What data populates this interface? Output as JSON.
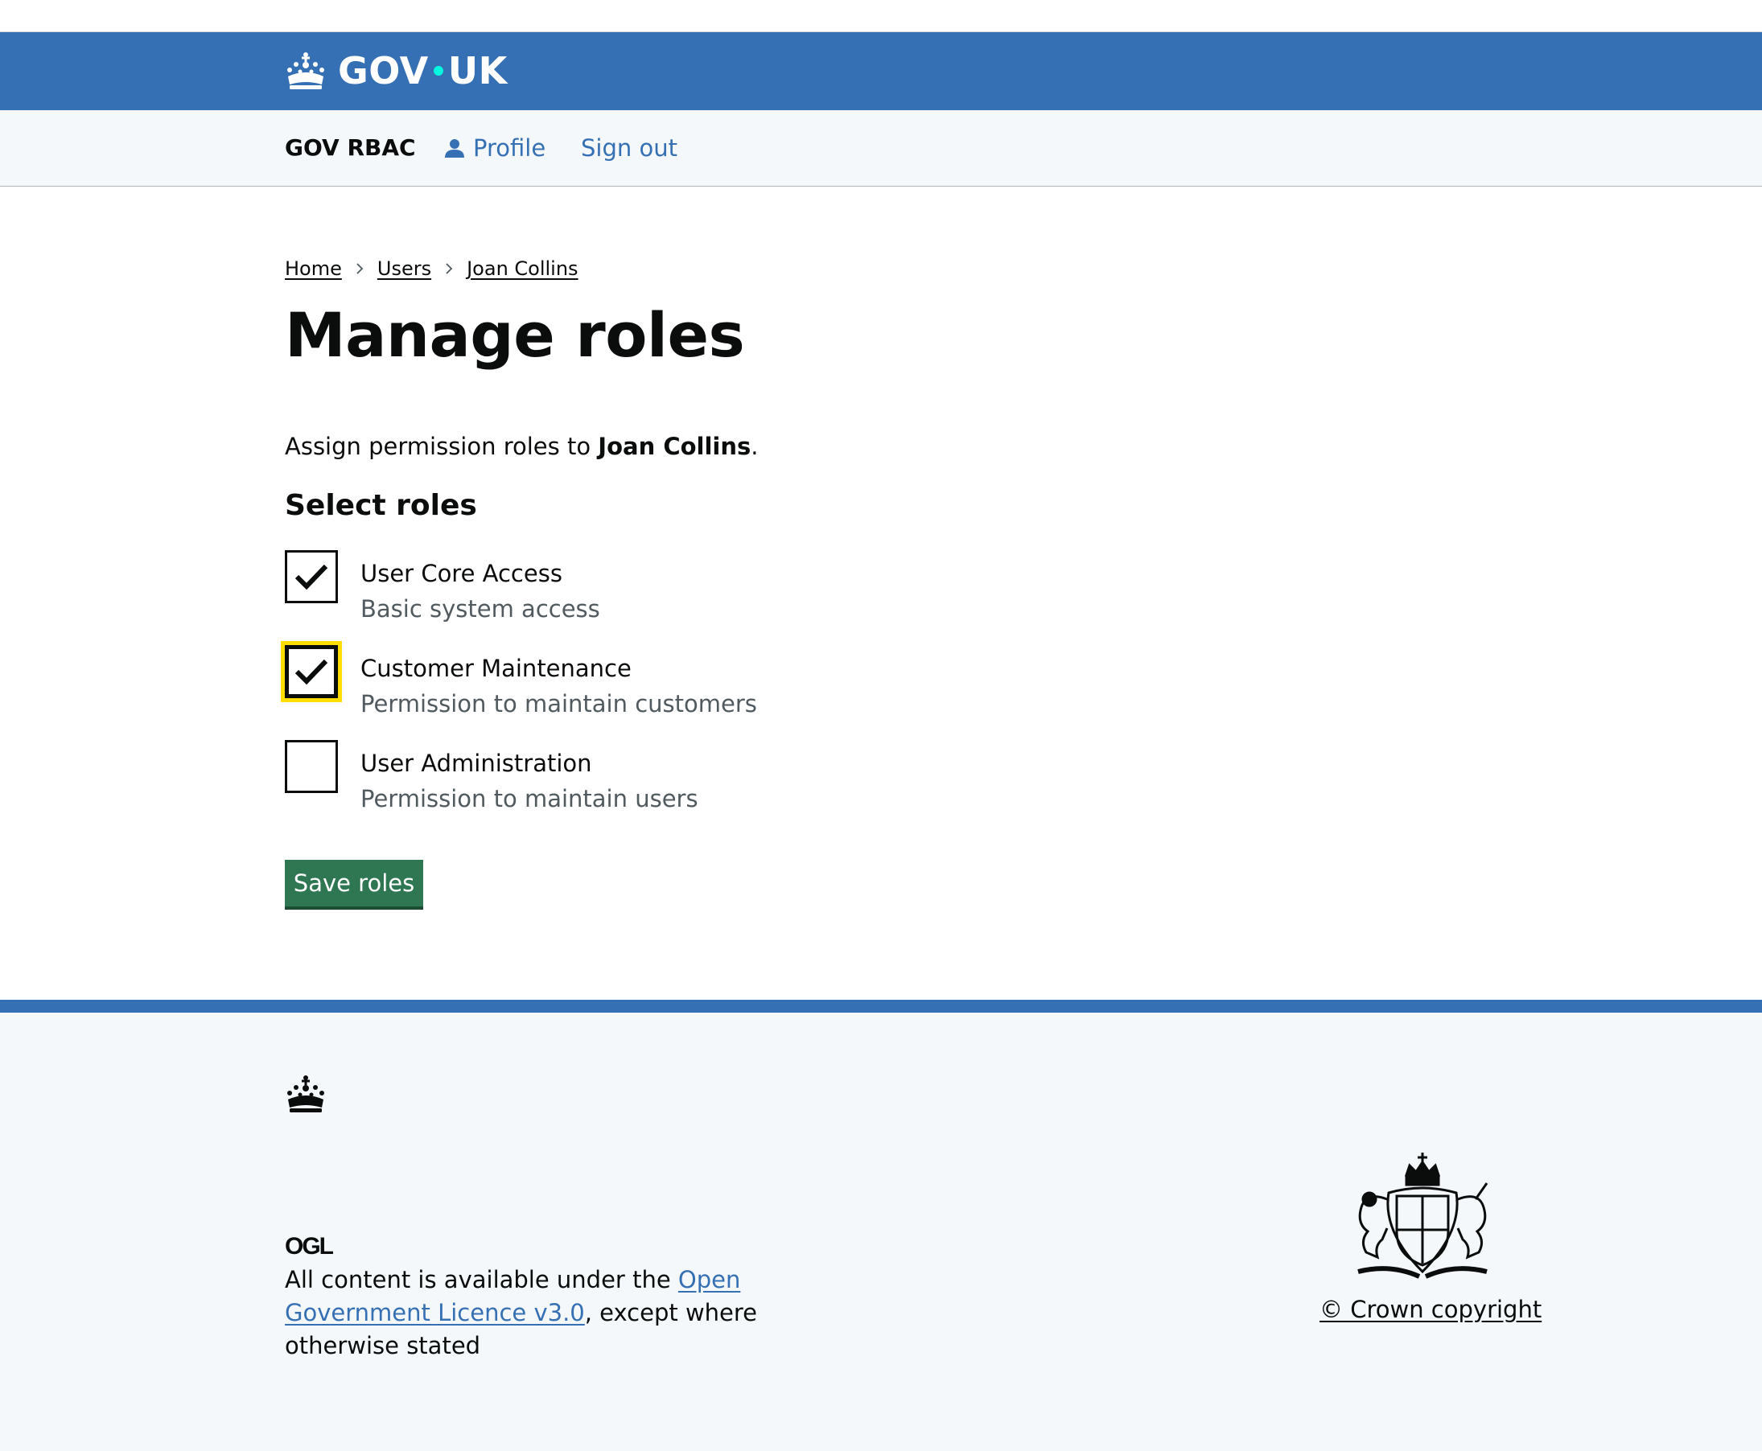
{
  "header": {
    "logo_text_left": "GOV",
    "logo_text_right": "UK",
    "logo_icon": "crown-icon",
    "brand_color": "#3670b4",
    "dot_color": "#00ffe0"
  },
  "service_nav": {
    "service_name": "GOV RBAC",
    "profile_label": "Profile",
    "profile_icon": "person-icon",
    "signout_label": "Sign out"
  },
  "breadcrumbs": [
    "Home",
    "Users",
    "Joan Collins"
  ],
  "page": {
    "title": "Manage roles",
    "lead_prefix": "Assign permission roles to ",
    "lead_name": "Joan Collins",
    "lead_suffix": ".",
    "legend": "Select roles"
  },
  "roles": [
    {
      "label": "User Core Access",
      "hint": "Basic system access",
      "checked": true,
      "focused": false
    },
    {
      "label": "Customer Maintenance",
      "hint": "Permission to maintain customers",
      "checked": true,
      "focused": true
    },
    {
      "label": "User Administration",
      "hint": "Permission to maintain users",
      "checked": false,
      "focused": false
    }
  ],
  "actions": {
    "save_label": "Save roles",
    "save_color": "#2f7653"
  },
  "footer": {
    "ogl_label": "OGL",
    "licence_prefix": "All content is available under the ",
    "licence_link": "Open Government Licence v3.0",
    "licence_suffix": ", except where otherwise stated",
    "crest_icon": "royal-coat-of-arms-icon",
    "copyright": "© Crown copyright"
  }
}
